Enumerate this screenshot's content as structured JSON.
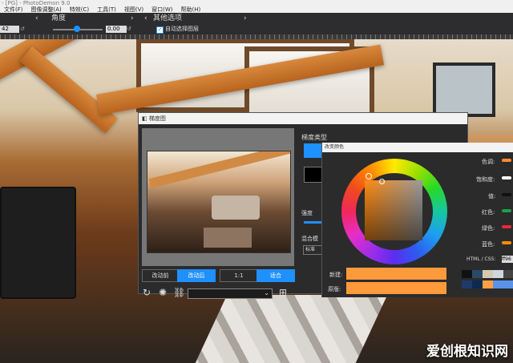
{
  "app": {
    "title_text": "- [PG] - PhotoDemon 9.0",
    "menu": [
      "文件(F)",
      "图像调整(A)",
      "特效(C)",
      "工具(T)",
      "视图(V)",
      "窗口(W)",
      "帮助(H)"
    ]
  },
  "toolbar": {
    "angle_label": "角度",
    "other_options_label": "其他选项",
    "angle_field_value": "42",
    "slider_value": "0.00",
    "auto_select_layer_label": "自动选择图层"
  },
  "gradient_dialog": {
    "title": "梯度图",
    "gradient_type_label": "梯度类型",
    "strength_label": "强度",
    "blend_mode_label": "混合模",
    "blend_mode_value": "标准",
    "before_label": "改动前",
    "after_label": "改动后",
    "ratio_label": "1:1",
    "fit_label": "适合",
    "colors": {
      "gradient_swatch": "#1e90ff",
      "accent": "#1e90ff"
    }
  },
  "color_dialog": {
    "title": "改变颜色",
    "hue_label": "色调:",
    "saturation_label": "饱和度:",
    "value_label": "值:",
    "red_label": "红色:",
    "green_label": "绿色:",
    "blue_label": "蓝色:",
    "html_css_label": "HTML / CSS:",
    "html_value": "ff96",
    "new_label": "新建:",
    "original_label": "原版:",
    "colors": {
      "new": "#ff9a3c",
      "original": "#ff9a3c"
    }
  },
  "watermark": {
    "text": "爱创根知识网"
  }
}
